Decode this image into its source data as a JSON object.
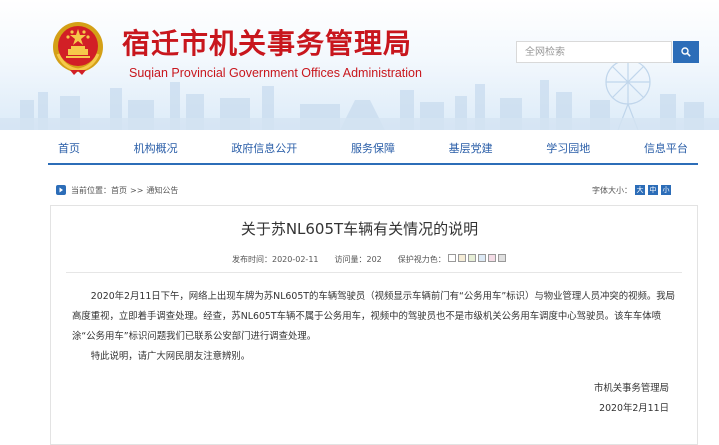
{
  "header": {
    "title": "宿迁市机关事务管理局",
    "subtitle": "Suqian Provincial Government Offices Administration"
  },
  "search": {
    "placeholder": "全网检索"
  },
  "nav": {
    "items": [
      {
        "label": "首页"
      },
      {
        "label": "机构概况"
      },
      {
        "label": "政府信息公开"
      },
      {
        "label": "服务保障"
      },
      {
        "label": "基层党建"
      },
      {
        "label": "学习园地"
      },
      {
        "label": "信息平台"
      }
    ]
  },
  "breadcrumb": {
    "label": "当前位置：",
    "home": "首页",
    "separator": ">>",
    "current": "通知公告"
  },
  "font_size": {
    "label": "字体大小：",
    "large": "大",
    "medium": "中",
    "small": "小"
  },
  "article": {
    "title": "关于苏NL605T车辆有关情况的说明",
    "date_label": "发布时间：",
    "date": "2020-02-11",
    "views_label": "访问量：",
    "views": "202",
    "vision_label": "保护视力色：",
    "vision_colors": [
      "#ffffff",
      "#f5ecd6",
      "#e6eed6",
      "#dce9f5",
      "#f4dce6",
      "#e0e0e0"
    ],
    "paragraphs": [
      "2020年2月11日下午，网络上出现车牌为苏NL605T的车辆驾驶员（视频显示车辆前门有“公务用车”标识）与物业管理人员冲突的视频。我局高度重视，立即着手调查处理。经查，苏NL605T车辆不属于公务用车，视频中的驾驶员也不是市级机关公务用车调度中心驾驶员。该车车体喷涂“公务用车”标识问题我们已联系公安部门进行调查处理。",
      "特此说明，请广大网民朋友注意辨别。"
    ],
    "signature": "市机关事务管理局",
    "signature_date": "2020年2月11日"
  },
  "colors": {
    "brand_red": "#c8161d",
    "brand_blue": "#2c6db8"
  },
  "icons": [
    "national-emblem-icon",
    "search-icon",
    "location-icon",
    "skyline-banner"
  ]
}
